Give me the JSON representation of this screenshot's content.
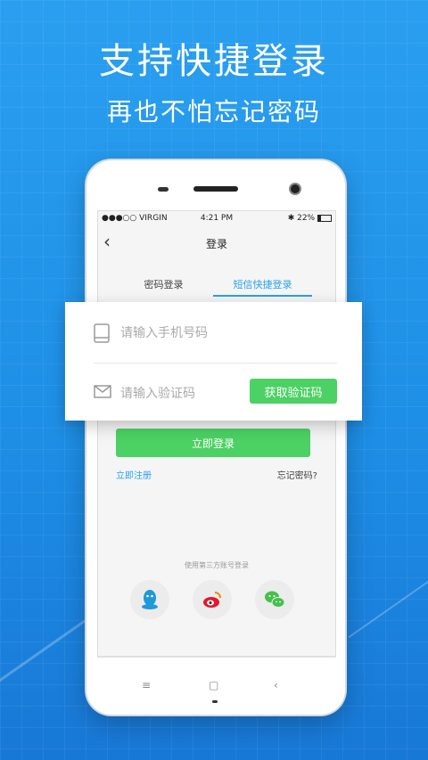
{
  "promo": {
    "headline": "支持快捷登录",
    "subline": "再也不怕忘记密码"
  },
  "status_bar": {
    "carrier": "●●●○○ VIRGIN",
    "time": "4:21 PM",
    "battery": "22%"
  },
  "nav": {
    "back_glyph": "‹",
    "title": "登录"
  },
  "tabs": [
    {
      "label": "密码登录",
      "active": false
    },
    {
      "label": "短信快捷登录",
      "active": true
    }
  ],
  "form": {
    "phone_placeholder": "请输入手机号码",
    "code_placeholder": "请输入验证码",
    "get_code_label": "获取验证码",
    "login_label": "立即登录",
    "register_link": "立即注册",
    "forgot_link": "忘记密码?"
  },
  "third_party": {
    "label": "使用第三方账号登录",
    "providers": [
      "qq-icon",
      "weibo-icon",
      "wechat-icon"
    ]
  },
  "softkeys": {
    "menu": "≡",
    "home": "▢",
    "back": "‹"
  },
  "colors": {
    "background": "#2a9ff0",
    "accent_blue": "#29a1e8",
    "button_green": "#4cd164",
    "qq": "#1e9ad6",
    "weibo": "#e6162d",
    "wechat": "#46c04d"
  }
}
